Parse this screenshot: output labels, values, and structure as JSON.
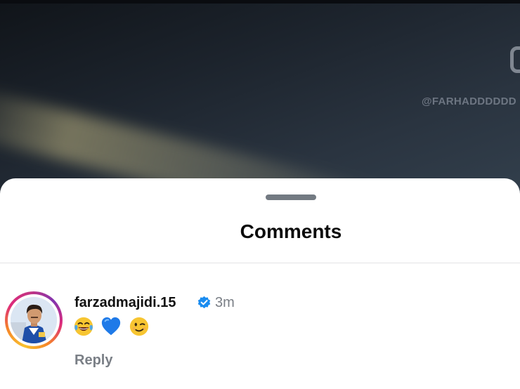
{
  "video": {
    "watermark_text": "@FARHADDDDDD"
  },
  "sheet": {
    "title": "Comments"
  },
  "comments": [
    {
      "username": "farzadmajidi.15",
      "verified": true,
      "time": "3m",
      "emojis": [
        "face-with-tears-of-joy",
        "blue-heart",
        "winking-face"
      ],
      "reply_label": "Reply"
    }
  ],
  "colors": {
    "verified_badge": "#1a8cf0",
    "muted_text": "#7a7f86",
    "handle": "#737a82"
  }
}
